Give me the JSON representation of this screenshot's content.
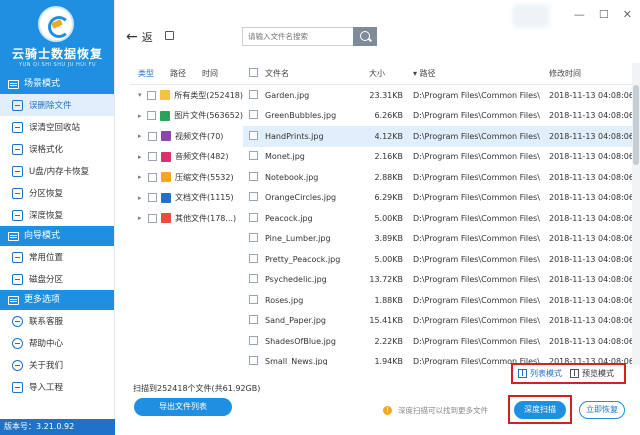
{
  "app": {
    "logo_title": "云骑士数据恢复",
    "logo_subtitle": "YUN QI SHI SHU JU HUI FU",
    "version": "版本号：3.21.0.92"
  },
  "sidebar": {
    "sections": [
      {
        "title": "场景模式",
        "items": [
          {
            "label": "误删除文件",
            "active": true
          },
          {
            "label": "误清空回收站",
            "active": false
          },
          {
            "label": "误格式化",
            "active": false
          },
          {
            "label": "U盘/内存卡恢复",
            "active": false
          },
          {
            "label": "分区恢复",
            "active": false
          },
          {
            "label": "深度恢复",
            "active": false
          }
        ]
      },
      {
        "title": "向导模式",
        "items": [
          {
            "label": "常用位置",
            "active": false
          },
          {
            "label": "磁盘分区",
            "active": false
          }
        ]
      },
      {
        "title": "更多选项",
        "items": [
          {
            "label": "联系客服",
            "active": false
          },
          {
            "label": "帮助中心",
            "active": false
          },
          {
            "label": "关于我们",
            "active": false
          },
          {
            "label": "导入工程",
            "active": false
          }
        ]
      }
    ]
  },
  "toolbar": {
    "back_label": "返",
    "search_placeholder": "请输入文件名搜索"
  },
  "tree": {
    "tabs": [
      "类型",
      "路径",
      "时间"
    ],
    "active_tab": 0,
    "rows": [
      {
        "label": "所有类型(252418)",
        "icon_color": "#f5c242",
        "has_caret": false
      },
      {
        "label": "图片文件(563652)",
        "icon_color": "#29a35a",
        "has_caret": true
      },
      {
        "label": "视频文件(70)",
        "icon_color": "#8e44ad",
        "has_caret": true
      },
      {
        "label": "音频文件(482)",
        "icon_color": "#d6336c",
        "has_caret": true
      },
      {
        "label": "压缩文件(5532)",
        "icon_color": "#f5a623",
        "has_caret": true
      },
      {
        "label": "文档文件(1115)",
        "icon_color": "#1e73c8",
        "has_caret": true
      },
      {
        "label": "其他文件(178...)",
        "icon_color": "#e74c3c",
        "has_caret": true
      }
    ]
  },
  "file_list": {
    "columns": {
      "name": "文件名",
      "size": "大小",
      "path": "路径",
      "time": "修改时间"
    },
    "rows": [
      {
        "name": "Garden.jpg",
        "size": "23.31KB",
        "path": "D:\\Program Files\\Common Files\\",
        "time": "2018-11-13 04:08:06"
      },
      {
        "name": "GreenBubbles.jpg",
        "size": "6.26KB",
        "path": "D:\\Program Files\\Common Files\\",
        "time": "2018-11-13 04:08:06"
      },
      {
        "name": "HandPrints.jpg",
        "size": "4.12KB",
        "path": "D:\\Program Files\\Common Files\\",
        "time": "2018-11-13 04:08:06"
      },
      {
        "name": "Monet.jpg",
        "size": "2.16KB",
        "path": "D:\\Program Files\\Common Files\\",
        "time": "2018-11-13 04:08:06"
      },
      {
        "name": "Notebook.jpg",
        "size": "2.88KB",
        "path": "D:\\Program Files\\Common Files\\",
        "time": "2018-11-13 04:08:06"
      },
      {
        "name": "OrangeCircles.jpg",
        "size": "6.29KB",
        "path": "D:\\Program Files\\Common Files\\",
        "time": "2018-11-13 04:08:06"
      },
      {
        "name": "Peacock.jpg",
        "size": "5.00KB",
        "path": "D:\\Program Files\\Common Files\\",
        "time": "2018-11-13 04:08:06"
      },
      {
        "name": "Pine_Lumber.jpg",
        "size": "3.89KB",
        "path": "D:\\Program Files\\Common Files\\",
        "time": "2018-11-13 04:08:06"
      },
      {
        "name": "Pretty_Peacock.jpg",
        "size": "5.00KB",
        "path": "D:\\Program Files\\Common Files\\",
        "time": "2018-11-13 04:08:06"
      },
      {
        "name": "Psychedelic.jpg",
        "size": "13.72KB",
        "path": "D:\\Program Files\\Common Files\\",
        "time": "2018-11-13 04:08:06"
      },
      {
        "name": "Roses.jpg",
        "size": "1.88KB",
        "path": "D:\\Program Files\\Common Files\\",
        "time": "2018-11-13 04:08:06"
      },
      {
        "name": "Sand_Paper.jpg",
        "size": "15.41KB",
        "path": "D:\\Program Files\\Common Files\\",
        "time": "2018-11-13 04:08:06"
      },
      {
        "name": "ShadesOfBlue.jpg",
        "size": "2.22KB",
        "path": "D:\\Program Files\\Common Files\\",
        "time": "2018-11-13 04:08:06"
      },
      {
        "name": "Small_News.jpg",
        "size": "1.94KB",
        "path": "D:\\Program Files\\Common Files\\",
        "time": "2018-11-13 04:08:06"
      }
    ],
    "selected_row": 2
  },
  "bottom": {
    "scan_info": "扫描到252418个文件(共61.92GB)",
    "export_label": "导出文件列表",
    "list_mode": "列表模式",
    "preview_mode": "预览模式",
    "hint": "深度扫描可以找到更多文件",
    "deep_scan_label": "深度扫描",
    "restore_label": "立即恢复"
  },
  "colors": {
    "primary": "#1e8fe1",
    "primary_dark": "#1e73c8",
    "highlight_border": "#d32020",
    "selected_row": "#e1eefb"
  }
}
